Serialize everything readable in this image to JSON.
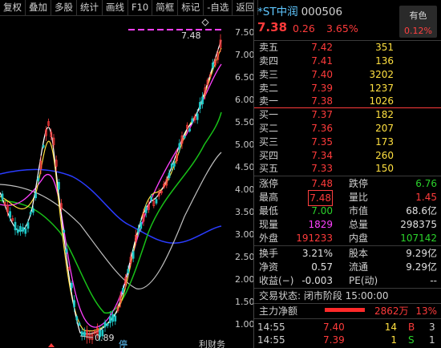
{
  "toolbar": [
    "复权",
    "叠加",
    "多股",
    "统计",
    "画线",
    "F10",
    "简框",
    "标记",
    "-自选",
    "返回"
  ],
  "chart": {
    "y_ticks": [
      "7.50",
      "7.00",
      "6.50",
      "6.00",
      "5.50",
      "5.00",
      "4.50",
      "4.00",
      "3.50",
      "3.00",
      "2.50",
      "2.00",
      "1.50",
      "1.00"
    ],
    "high_label": "7.48",
    "low_label": "0.89",
    "bottom_label_1": "停",
    "bottom_label_2": "利财务"
  },
  "stock": {
    "name": "*ST中润",
    "code": "000506",
    "price": "7.38",
    "change": "0.26",
    "change_pct": "3.65%",
    "sector": "有色",
    "sector_pct": "0.12%"
  },
  "asks": [
    {
      "label": "卖五",
      "price": "7.42",
      "vol": "351"
    },
    {
      "label": "卖四",
      "price": "7.41",
      "vol": "136"
    },
    {
      "label": "卖三",
      "price": "7.40",
      "vol": "3202"
    },
    {
      "label": "卖二",
      "price": "7.39",
      "vol": "1237"
    },
    {
      "label": "卖一",
      "price": "7.38",
      "vol": "1026"
    }
  ],
  "bids": [
    {
      "label": "买一",
      "price": "7.37",
      "vol": "182"
    },
    {
      "label": "买二",
      "price": "7.36",
      "vol": "207"
    },
    {
      "label": "买三",
      "price": "7.35",
      "vol": "173"
    },
    {
      "label": "买四",
      "price": "7.34",
      "vol": "260"
    },
    {
      "label": "买五",
      "price": "7.33",
      "vol": "150"
    }
  ],
  "stats": {
    "limit_up_label": "涨停",
    "limit_up": "7.48",
    "limit_down_label": "跌停",
    "limit_down": "6.76",
    "high_label": "最高",
    "high": "7.48",
    "vol_ratio_label": "量比",
    "vol_ratio": "1.45",
    "low_label": "最低",
    "low": "7.00",
    "mcap_label": "市值",
    "mcap": "68.6亿",
    "cur_vol_label": "现量",
    "cur_vol": "1829",
    "total_vol_label": "总量",
    "total_vol": "298375",
    "outer_label": "外盘",
    "outer": "191233",
    "inner_label": "内盘",
    "inner": "107142",
    "turnover_label": "换手",
    "turnover": "3.21%",
    "share_label": "股本",
    "share": "9.29亿",
    "net_asset_label": "净资",
    "net_asset": "0.57",
    "float_label": "流通",
    "float": "9.29亿",
    "eps_label": "收益(−)",
    "eps": "-0.003",
    "pe_label": "PE(动)",
    "pe": "--"
  },
  "trade_status": "交易状态: 闭市阶段 15:00:00",
  "main_flow": {
    "label": "主力净额",
    "value": "2862万",
    "pct": "13%"
  },
  "trades": [
    {
      "time": "14:55",
      "price": "7.40",
      "qty": "14",
      "bs": "B",
      "n": "3"
    },
    {
      "time": "14:55",
      "price": "7.39",
      "qty": "1",
      "bs": "S",
      "n": "1"
    }
  ]
}
